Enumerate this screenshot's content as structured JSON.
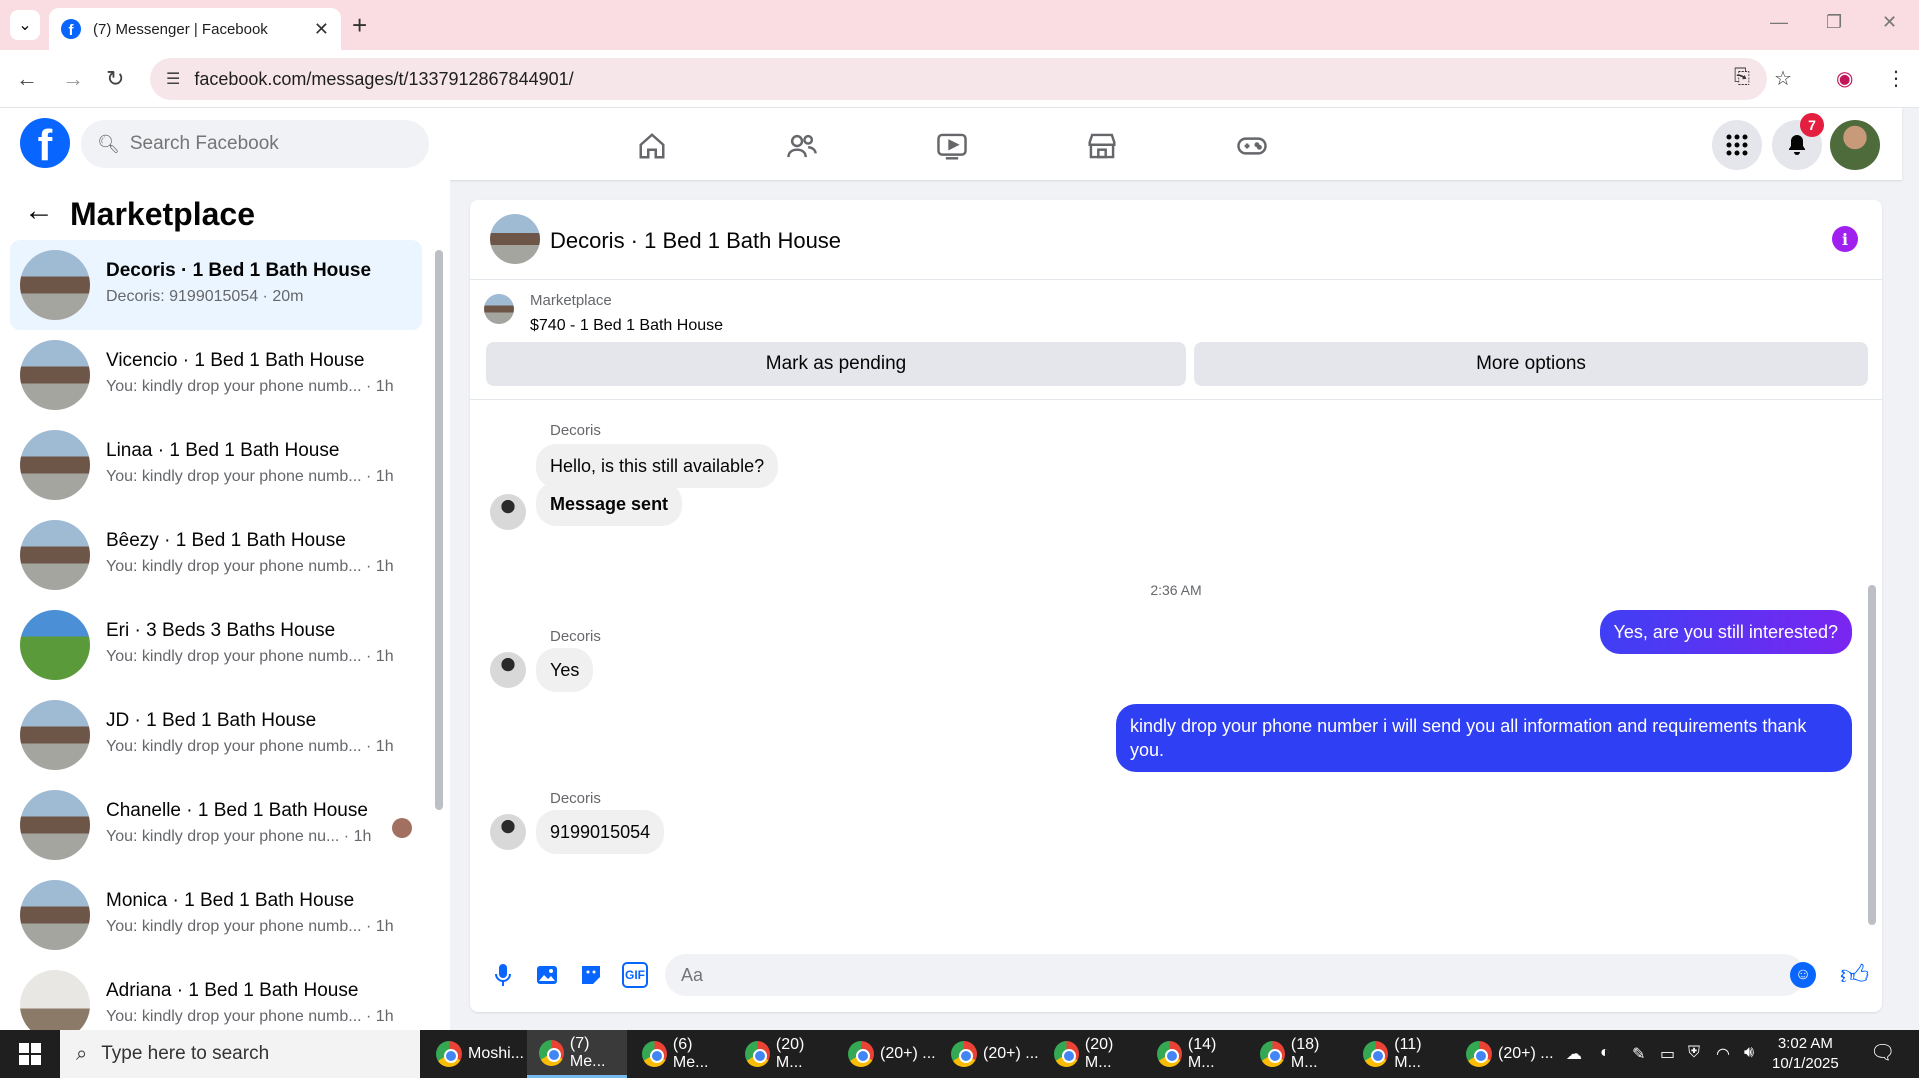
{
  "browser": {
    "tab_title": "(7) Messenger | Facebook",
    "url": "facebook.com/messages/t/1337912867844901/"
  },
  "header": {
    "search_placeholder": "Search Facebook",
    "notification_count": "7"
  },
  "sidebar": {
    "title": "Marketplace",
    "conversations": [
      {
        "name": "Decoris · 1 Bed 1 Bath House",
        "preview": "Decoris: 9199015054 · 20m",
        "active": true
      },
      {
        "name": "Vicencio · 1 Bed 1 Bath House",
        "preview": "You: kindly drop your phone numb... · 1h"
      },
      {
        "name": "Linaa · 1 Bed 1 Bath House",
        "preview": "You: kindly drop your phone numb... · 1h"
      },
      {
        "name": "Bêezy · 1 Bed 1 Bath House",
        "preview": "You: kindly drop your phone numb... · 1h"
      },
      {
        "name": "Eri · 3 Beds 3 Baths House",
        "preview": "You: kindly drop your phone numb... · 1h"
      },
      {
        "name": "JD · 1 Bed 1 Bath House",
        "preview": "You: kindly drop your phone numb... · 1h"
      },
      {
        "name": "Chanelle · 1 Bed 1 Bath House",
        "preview": "You: kindly drop your phone nu... · 1h"
      },
      {
        "name": "Monica · 1 Bed 1 Bath House",
        "preview": "You: kindly drop your phone numb... · 1h"
      },
      {
        "name": "Adriana · 1 Bed 1 Bath House",
        "preview": "You: kindly drop your phone numb... · 1h"
      }
    ]
  },
  "chat": {
    "title": "Decoris · 1 Bed 1 Bath House",
    "listing_category": "Marketplace",
    "listing_price": "$740 - 1 Bed 1 Bath House",
    "mark_pending_label": "Mark as pending",
    "more_options_label": "More options",
    "messages": {
      "sender": "Decoris",
      "m1": "Hello, is this still available?",
      "m2": "Message sent",
      "timestamp": "2:36 AM",
      "m3": "Yes, are you still interested?",
      "m4": "Yes",
      "m5": "kindly drop your phone number i will send you all information and requirements thank you.",
      "m6": "9199015054"
    },
    "composer_placeholder": "Aa"
  },
  "taskbar": {
    "search_text": "Type here to search",
    "apps": [
      "Moshi...",
      "(7) Me...",
      "(6) Me...",
      "(20) M...",
      "(20+) ...",
      "(20+) ...",
      "(20) M...",
      "(14) M...",
      "(18) M...",
      "(11) M...",
      "(20+) ..."
    ],
    "time": "3:02 AM",
    "date": "10/1/2025"
  }
}
